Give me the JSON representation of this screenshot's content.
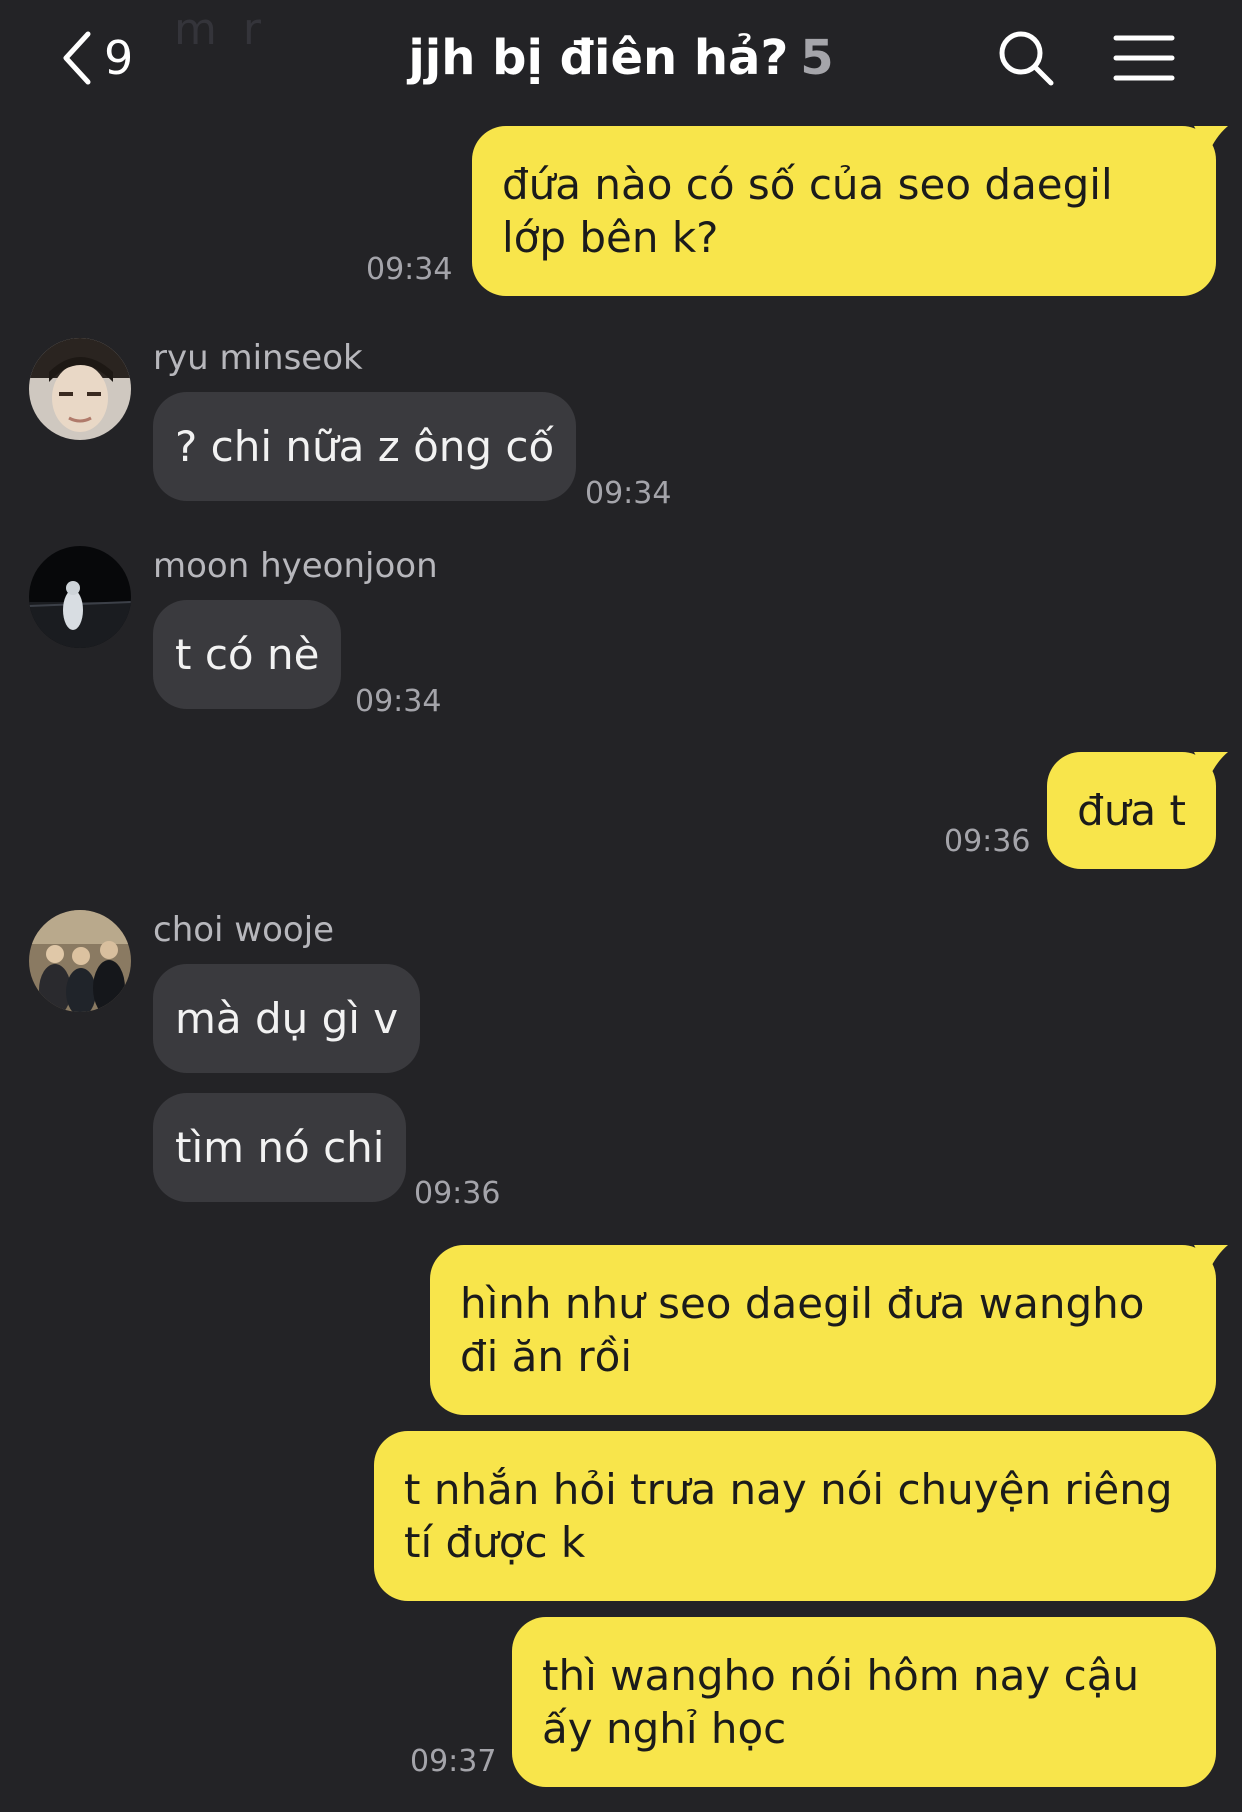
{
  "header": {
    "back_count": "9",
    "ghost_text": "m r",
    "title": "jjh bị điên hả?",
    "member_count": "5"
  },
  "colors": {
    "background": "#232326",
    "outgoing_bubble": "#f8e54b",
    "incoming_bubble": "#3a3a3e",
    "time_text": "#a4a4aa"
  },
  "messages": [
    {
      "sender": "me",
      "text": "đứa nào có số của seo daegil lớp bên k?",
      "time": "09:34"
    },
    {
      "sender": "ryu minseok",
      "text": "? chi nữa z ông cố",
      "time": "09:34"
    },
    {
      "sender": "moon hyeonjoon",
      "text": "t có nè",
      "time": "09:34"
    },
    {
      "sender": "me",
      "text": "đưa t",
      "time": "09:36"
    },
    {
      "sender": "choi wooje",
      "text": "mà dụ gì v",
      "time": ""
    },
    {
      "sender": "choi wooje",
      "text": "tìm nó chi",
      "time": "09:36"
    },
    {
      "sender": "me",
      "text": "hình như seo daegil đưa wangho đi ăn rồi",
      "time": ""
    },
    {
      "sender": "me",
      "text": "t nhắn hỏi trưa nay nói chuyện riêng tí được k",
      "time": ""
    },
    {
      "sender": "me",
      "text": "thì wangho nói hôm nay cậu ấy nghỉ học",
      "time": "09:37"
    }
  ]
}
